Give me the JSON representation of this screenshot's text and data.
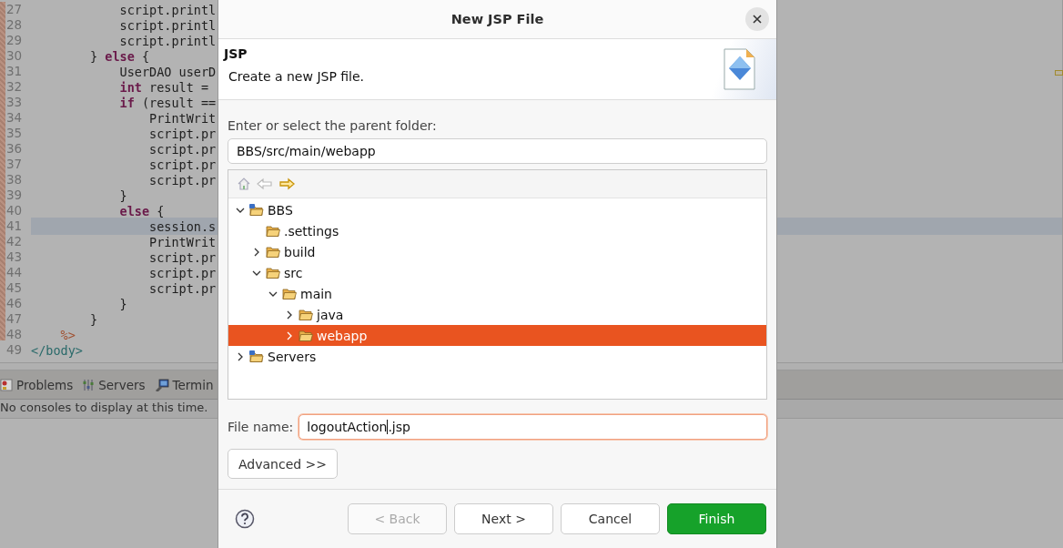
{
  "editor": {
    "lines": [
      {
        "number": "27",
        "text": "            script.printl",
        "kind": "code",
        "current": false
      },
      {
        "number": "28",
        "text": "            script.printl",
        "kind": "code",
        "current": false
      },
      {
        "number": "29",
        "text": "            script.printl",
        "kind": "code",
        "current": false
      },
      {
        "number": "30",
        "text": "        } **else** {",
        "kind": "code",
        "current": false
      },
      {
        "number": "31",
        "text": "            UserDAO userD",
        "kind": "code",
        "current": false
      },
      {
        "number": "32",
        "text": "            **int** result =",
        "kind": "code",
        "current": false
      },
      {
        "number": "33",
        "text": "            **if** (result ==",
        "kind": "code",
        "current": false
      },
      {
        "number": "34",
        "text": "                PrintWrit",
        "kind": "code",
        "current": false
      },
      {
        "number": "35",
        "text": "                script.pr",
        "kind": "code",
        "current": false
      },
      {
        "number": "36",
        "text": "                script.pr",
        "kind": "code",
        "current": false
      },
      {
        "number": "37",
        "text": "                script.pr",
        "kind": "code",
        "current": false
      },
      {
        "number": "38",
        "text": "                script.pr",
        "kind": "code",
        "current": false
      },
      {
        "number": "39",
        "text": "            }",
        "kind": "code",
        "current": false
      },
      {
        "number": "40",
        "text": "            **else** {",
        "kind": "code",
        "current": false
      },
      {
        "number": "41",
        "text": "                session.s",
        "kind": "code",
        "current": true
      },
      {
        "number": "42",
        "text": "                PrintWrit",
        "kind": "code",
        "current": false
      },
      {
        "number": "43",
        "text": "                script.pr",
        "kind": "code",
        "current": false
      },
      {
        "number": "44",
        "text": "                script.pr",
        "kind": "code",
        "current": false
      },
      {
        "number": "45",
        "text": "                script.pr",
        "kind": "code",
        "current": false
      },
      {
        "number": "46",
        "text": "            }",
        "kind": "code",
        "current": false
      },
      {
        "number": "47",
        "text": "        }",
        "kind": "code",
        "current": false
      },
      {
        "number": "48",
        "text": "    %>",
        "kind": "scriptlet",
        "current": false
      },
      {
        "number": "49",
        "text": "</body>",
        "kind": "tag",
        "current": false
      }
    ]
  },
  "panel": {
    "tabs": [
      {
        "label": "Problems"
      },
      {
        "label": "Servers"
      },
      {
        "label": "Termin"
      }
    ],
    "message": "No consoles to display at this time."
  },
  "dialog": {
    "title": "New JSP File",
    "header": {
      "title": "JSP",
      "description": "Create a new JSP file."
    },
    "folder_label": "Enter or select the parent folder:",
    "folder_value": "BBS/src/main/webapp",
    "tree": [
      {
        "label": "BBS",
        "kind": "project",
        "expanded": true,
        "selected": false,
        "children": [
          {
            "label": ".settings",
            "kind": "folder",
            "selected": false
          },
          {
            "label": "build",
            "kind": "folder",
            "expanded": false,
            "selected": false
          },
          {
            "label": "src",
            "kind": "folder",
            "expanded": true,
            "selected": false,
            "children": [
              {
                "label": "main",
                "kind": "folder",
                "expanded": true,
                "selected": false,
                "children": [
                  {
                    "label": "java",
                    "kind": "folder",
                    "expanded": false,
                    "selected": false
                  },
                  {
                    "label": "webapp",
                    "kind": "folder",
                    "expanded": false,
                    "selected": true
                  }
                ]
              }
            ]
          }
        ]
      },
      {
        "label": "Servers",
        "kind": "project",
        "expanded": false,
        "selected": false
      }
    ],
    "file_name_label": "File name:",
    "file_name_value": "logoutAction.jsp",
    "advanced_button": "Advanced >>",
    "buttons": [
      {
        "label": "< Back",
        "kind": "secondary",
        "disabled": true
      },
      {
        "label": "Next >",
        "kind": "secondary",
        "disabled": false
      },
      {
        "label": "Cancel",
        "kind": "secondary",
        "disabled": false
      },
      {
        "label": "Finish",
        "kind": "primary",
        "disabled": false
      }
    ]
  }
}
